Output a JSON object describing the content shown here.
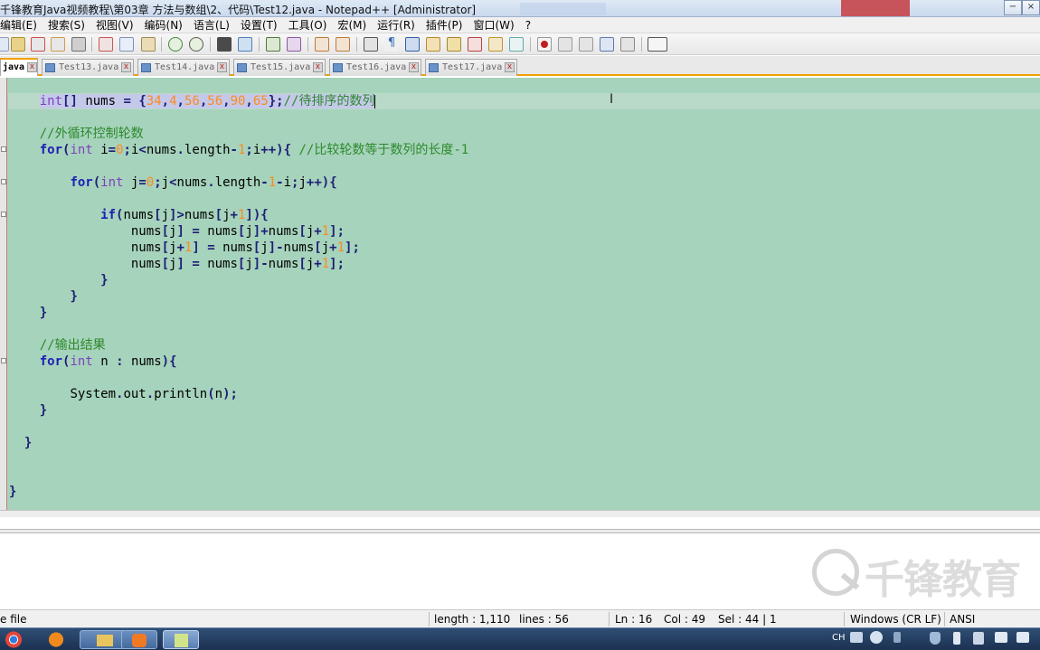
{
  "window": {
    "title": "千锋教育Java视频教程\\第03章 方法与数组\\2、代码\\Test12.java - Notepad++ [Administrator]",
    "controls": [
      "−",
      "×"
    ]
  },
  "menu": [
    "编辑(E)",
    "搜索(S)",
    "视图(V)",
    "编码(N)",
    "语言(L)",
    "设置(T)",
    "工具(O)",
    "宏(M)",
    "运行(R)",
    "插件(P)",
    "窗口(W)",
    "?"
  ],
  "tabs": [
    {
      "label": "java",
      "active": true
    },
    {
      "label": "Test13.java",
      "active": false
    },
    {
      "label": "Test14.java",
      "active": false
    },
    {
      "label": "Test15.java",
      "active": false
    },
    {
      "label": "Test16.java",
      "active": false
    },
    {
      "label": "Test17.java",
      "active": false
    }
  ],
  "tab_close_glyph": "x",
  "editor": {
    "lines": [
      {
        "text": "    int[] nums = {34,4,56,56,90,65};//待排序的数列",
        "selected": true
      },
      {
        "text": ""
      },
      {
        "text": "    //外循环控制轮数"
      },
      {
        "text": "    for(int i=0;i<nums.length-1;i++){ //比较轮数等于数列的长度-1"
      },
      {
        "text": ""
      },
      {
        "text": "        for(int j=0;j<nums.length-1-i;j++){"
      },
      {
        "text": ""
      },
      {
        "text": "            if(nums[j]>nums[j+1]){"
      },
      {
        "text": "                nums[j] = nums[j]+nums[j+1];"
      },
      {
        "text": "                nums[j+1] = nums[j]-nums[j+1];"
      },
      {
        "text": "                nums[j] = nums[j]-nums[j+1];"
      },
      {
        "text": "            }"
      },
      {
        "text": "        }"
      },
      {
        "text": "    }"
      },
      {
        "text": ""
      },
      {
        "text": "    //输出结果"
      },
      {
        "text": "    for(int n : nums){"
      },
      {
        "text": ""
      },
      {
        "text": "        System.out.println(n);"
      },
      {
        "text": "    }"
      },
      {
        "text": ""
      },
      {
        "text": "  }"
      },
      {
        "text": ""
      },
      {
        "text": ""
      },
      {
        "text": "}"
      }
    ]
  },
  "watermark": "千锋教育",
  "status": {
    "file_type": "e file",
    "length": "length : 1,110",
    "lines": "lines : 56",
    "ln": "Ln : 16",
    "col": "Col : 49",
    "sel": "Sel : 44 | 1",
    "eol": "Windows (CR LF)",
    "encoding": "ANSI"
  },
  "taskbar": {
    "items": [
      "chrome-icon",
      "firefox-icon",
      "explorer-icon",
      "app-icon",
      "notepadpp-icon"
    ],
    "tray_lang": "CH"
  },
  "colors": {
    "editor_bg": "#a6d3bb",
    "keyword": "#1d1db8",
    "number": "#ff8a1e",
    "comment": "#2d8a2d",
    "active_tab_accent": "#f2a000"
  }
}
